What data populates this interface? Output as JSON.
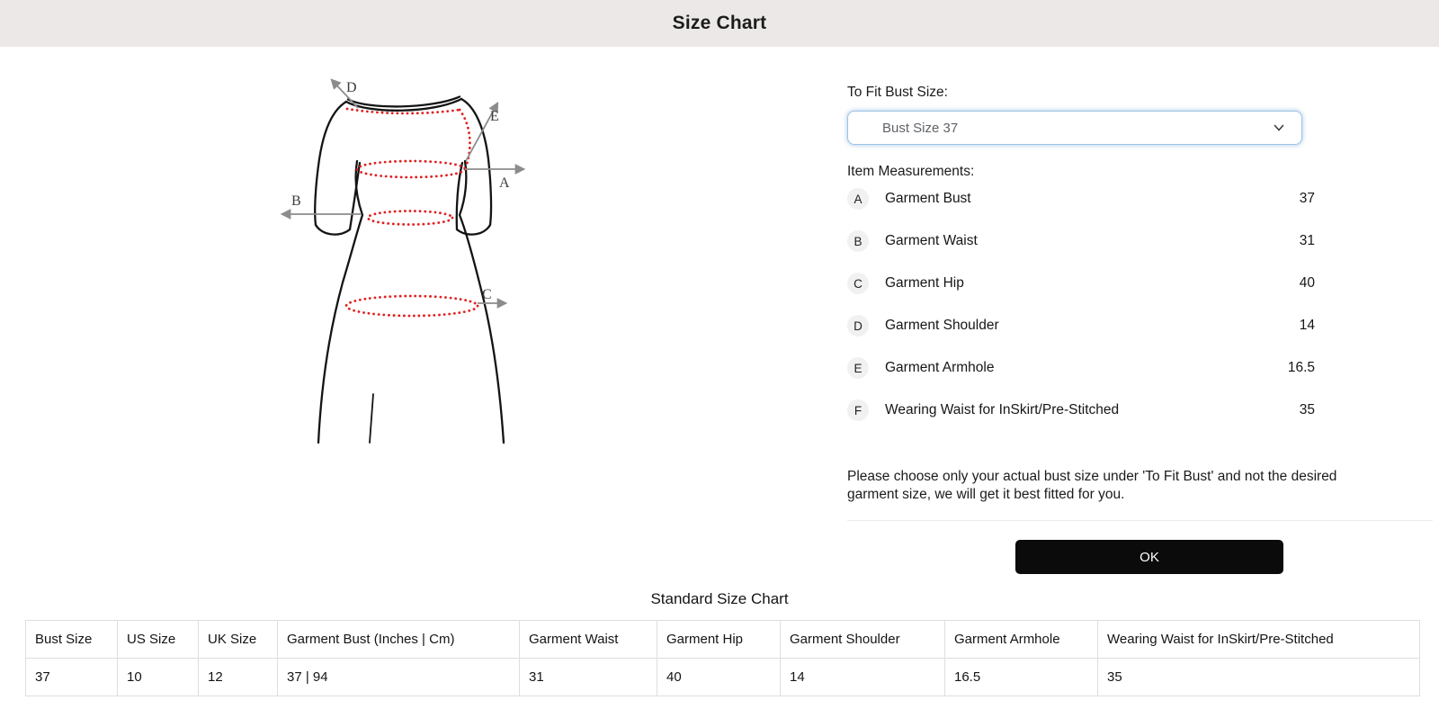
{
  "header": {
    "title": "Size Chart"
  },
  "fit_selector": {
    "label": "To Fit Bust Size:",
    "selected_option": "Bust Size 37"
  },
  "measurements": {
    "label": "Item Measurements:",
    "items": [
      {
        "letter": "A",
        "name": "Garment Bust",
        "value": "37"
      },
      {
        "letter": "B",
        "name": "Garment Waist",
        "value": "31"
      },
      {
        "letter": "C",
        "name": "Garment Hip",
        "value": "40"
      },
      {
        "letter": "D",
        "name": "Garment Shoulder",
        "value": "14"
      },
      {
        "letter": "E",
        "name": "Garment Armhole",
        "value": "16.5"
      },
      {
        "letter": "F",
        "name": "Wearing Waist for InSkirt/Pre-Stitched",
        "value": "35"
      }
    ]
  },
  "note": "Please choose only your actual bust size under 'To Fit Bust' and not the desired\ngarment size, we will get it best fitted for you.",
  "ok_button": {
    "label": "OK"
  },
  "size_chart": {
    "title": "Standard Size Chart",
    "headers": [
      "Bust Size",
      "US Size",
      "UK Size",
      "Garment Bust (Inches | Cm)",
      "Garment Waist",
      "Garment Hip",
      "Garment Shoulder",
      "Garment Armhole",
      "Wearing Waist for InSkirt/Pre-Stitched"
    ],
    "rows": [
      [
        "37",
        "10",
        "12",
        "37 | 94",
        "31",
        "40",
        "14",
        "16.5",
        "35"
      ]
    ]
  },
  "diagram": {
    "labels": {
      "a": "A",
      "b": "B",
      "c": "C",
      "d": "D",
      "e": "E"
    },
    "dot_color": "#e02020",
    "arrow_color": "#8c8c8c",
    "outline_color": "#141414"
  },
  "colors": {
    "header_bg": "#ece8e7",
    "select_border": "#9dc3e6",
    "ok_bg": "#0b0b0b",
    "table_border": "#dedede"
  }
}
